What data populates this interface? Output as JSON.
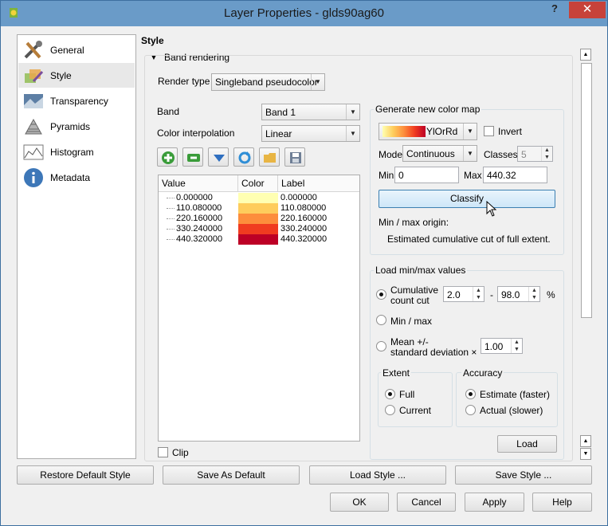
{
  "window": {
    "title": "Layer Properties - glds90ag60",
    "help": "?",
    "close": "✕"
  },
  "sidebar": {
    "items": [
      {
        "label": "General",
        "icon": "tools-icon"
      },
      {
        "label": "Style",
        "icon": "paint-icon"
      },
      {
        "label": "Transparency",
        "icon": "transparency-icon"
      },
      {
        "label": "Pyramids",
        "icon": "pyramids-icon"
      },
      {
        "label": "Histogram",
        "icon": "histogram-icon"
      },
      {
        "label": "Metadata",
        "icon": "info-icon"
      }
    ]
  },
  "main": {
    "heading": "Style",
    "section": "Band rendering",
    "render_type_label": "Render type",
    "render_type_value": "Singleband pseudocolor",
    "band_label": "Band",
    "band_value": "Band 1",
    "interp_label": "Color interpolation",
    "interp_value": "Linear",
    "table": {
      "headers": [
        "Value",
        "Color",
        "Label"
      ],
      "rows": [
        {
          "value": "0.000000",
          "color": "#ffffb2",
          "label": "0.000000"
        },
        {
          "value": "110.080000",
          "color": "#fecc5c",
          "label": "110.080000"
        },
        {
          "value": "220.160000",
          "color": "#fd8d3c",
          "label": "220.160000"
        },
        {
          "value": "330.240000",
          "color": "#f03b20",
          "label": "330.240000"
        },
        {
          "value": "440.320000",
          "color": "#bd0026",
          "label": "440.320000"
        }
      ]
    },
    "clip_label": "Clip",
    "gen": {
      "title": "Generate new color map",
      "ramp": "YlOrRd",
      "invert": "Invert",
      "mode_label": "Mode",
      "mode_value": "Continuous",
      "classes_label": "Classes",
      "classes_value": "5",
      "min_label": "Min",
      "min_value": "0",
      "max_label": "Max",
      "max_value": "440.32",
      "classify": "Classify",
      "origin_label": "Min / max origin:",
      "origin_text": "Estimated cumulative cut of full extent."
    },
    "load": {
      "title": "Load min/max values",
      "cum_label_1": "Cumulative",
      "cum_label_2": "count cut",
      "cum_low": "2.0",
      "dash": "-",
      "cum_high": "98.0",
      "pct": "%",
      "minmax": "Min / max",
      "mean_1": "Mean +/-",
      "mean_2": "standard deviation ×",
      "std_value": "1.00",
      "extent_title": "Extent",
      "full": "Full",
      "current": "Current",
      "accuracy_title": "Accuracy",
      "estimate": "Estimate (faster)",
      "actual": "Actual (slower)",
      "load_btn": "Load"
    }
  },
  "bottom": {
    "restore": "Restore Default Style",
    "save_default": "Save As Default",
    "load_style": "Load Style ...",
    "save_style": "Save Style ...",
    "ok": "OK",
    "cancel": "Cancel",
    "apply": "Apply",
    "help": "Help"
  }
}
